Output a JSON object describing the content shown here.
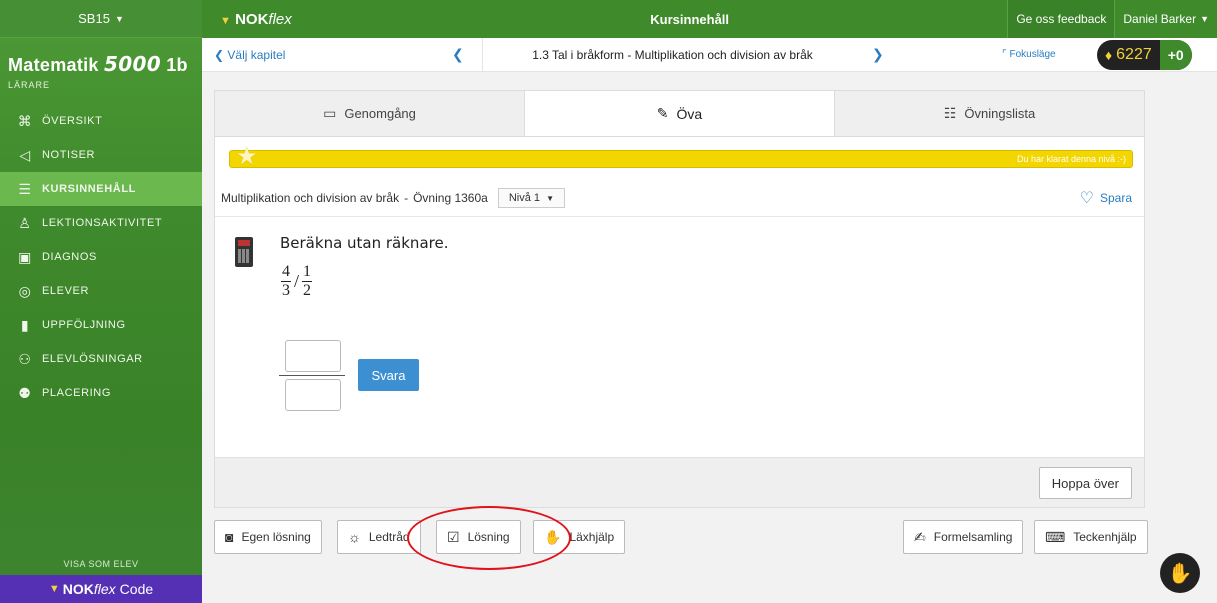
{
  "sidebar": {
    "group_selector": "SB15",
    "brand": {
      "name": "Matematik",
      "number": "5000",
      "suffix": "1b"
    },
    "role": "LÄRARE",
    "items": [
      {
        "label": "ÖVERSIKT",
        "icon": "binoculars-icon"
      },
      {
        "label": "NOTISER",
        "icon": "megaphone-icon"
      },
      {
        "label": "KURSINNEHÅLL",
        "icon": "list-icon",
        "active": true
      },
      {
        "label": "LEKTIONSAKTIVITET",
        "icon": "person-icon"
      },
      {
        "label": "DIAGNOS",
        "icon": "diagnosis-icon"
      },
      {
        "label": "ELEVER",
        "icon": "student-icon"
      },
      {
        "label": "UPPFÖLJNING",
        "icon": "bars-icon"
      },
      {
        "label": "ELEVLÖSNINGAR",
        "icon": "student-solutions-icon"
      },
      {
        "label": "PLACERING",
        "icon": "group-icon"
      }
    ],
    "view_as_student": "VISA SOM ELEV",
    "code_brand": {
      "nok": "NOK",
      "flex": "flex",
      "code": "Code"
    }
  },
  "topbar": {
    "logo_nok": "NOK",
    "logo_flex": "flex",
    "title": "Kursinnehåll",
    "feedback": "Ge oss feedback",
    "user": "Daniel Barker"
  },
  "chapter": {
    "back": "Välj kapitel",
    "name": "1.3 Tal i bråkform - Multiplikation och division av bråk",
    "focus": "Fokusläge",
    "score": "6227",
    "delta": "+0"
  },
  "tabs": [
    {
      "label": "Genomgång",
      "icon": "book-icon"
    },
    {
      "label": "Öva",
      "icon": "pencil-icon",
      "active": true
    },
    {
      "label": "Övningslista",
      "icon": "checklist-icon"
    }
  ],
  "progress": {
    "message": "Du har klarat denna nivå :-)",
    "fraction": 1.0
  },
  "exercise": {
    "topic": "Multiplikation och division av bråk",
    "separator": "-",
    "number": "Övning 1360a",
    "level": "Nivå 1",
    "save": "Spara",
    "question": "Beräkna utan räknare.",
    "fraction_a": {
      "numerator": "4",
      "denominator": "3"
    },
    "operator": "/",
    "fraction_b": {
      "numerator": "1",
      "denominator": "2"
    },
    "submit": "Svara",
    "skip": "Hoppa över"
  },
  "tools": {
    "own_solution": "Egen lösning",
    "hint": "Ledtråd",
    "solution": "Lösning",
    "homework_help": "Läxhjälp",
    "formulas": "Formelsamling",
    "char_help": "Teckenhjälp"
  },
  "colors": {
    "sidebar_green": "#3f8a2c",
    "active_green": "#6ab84e",
    "accent_blue": "#2b7dc1",
    "progress_yellow": "#f3d600",
    "highlight_red": "#e0131a",
    "code_purple": "#5530b5"
  }
}
